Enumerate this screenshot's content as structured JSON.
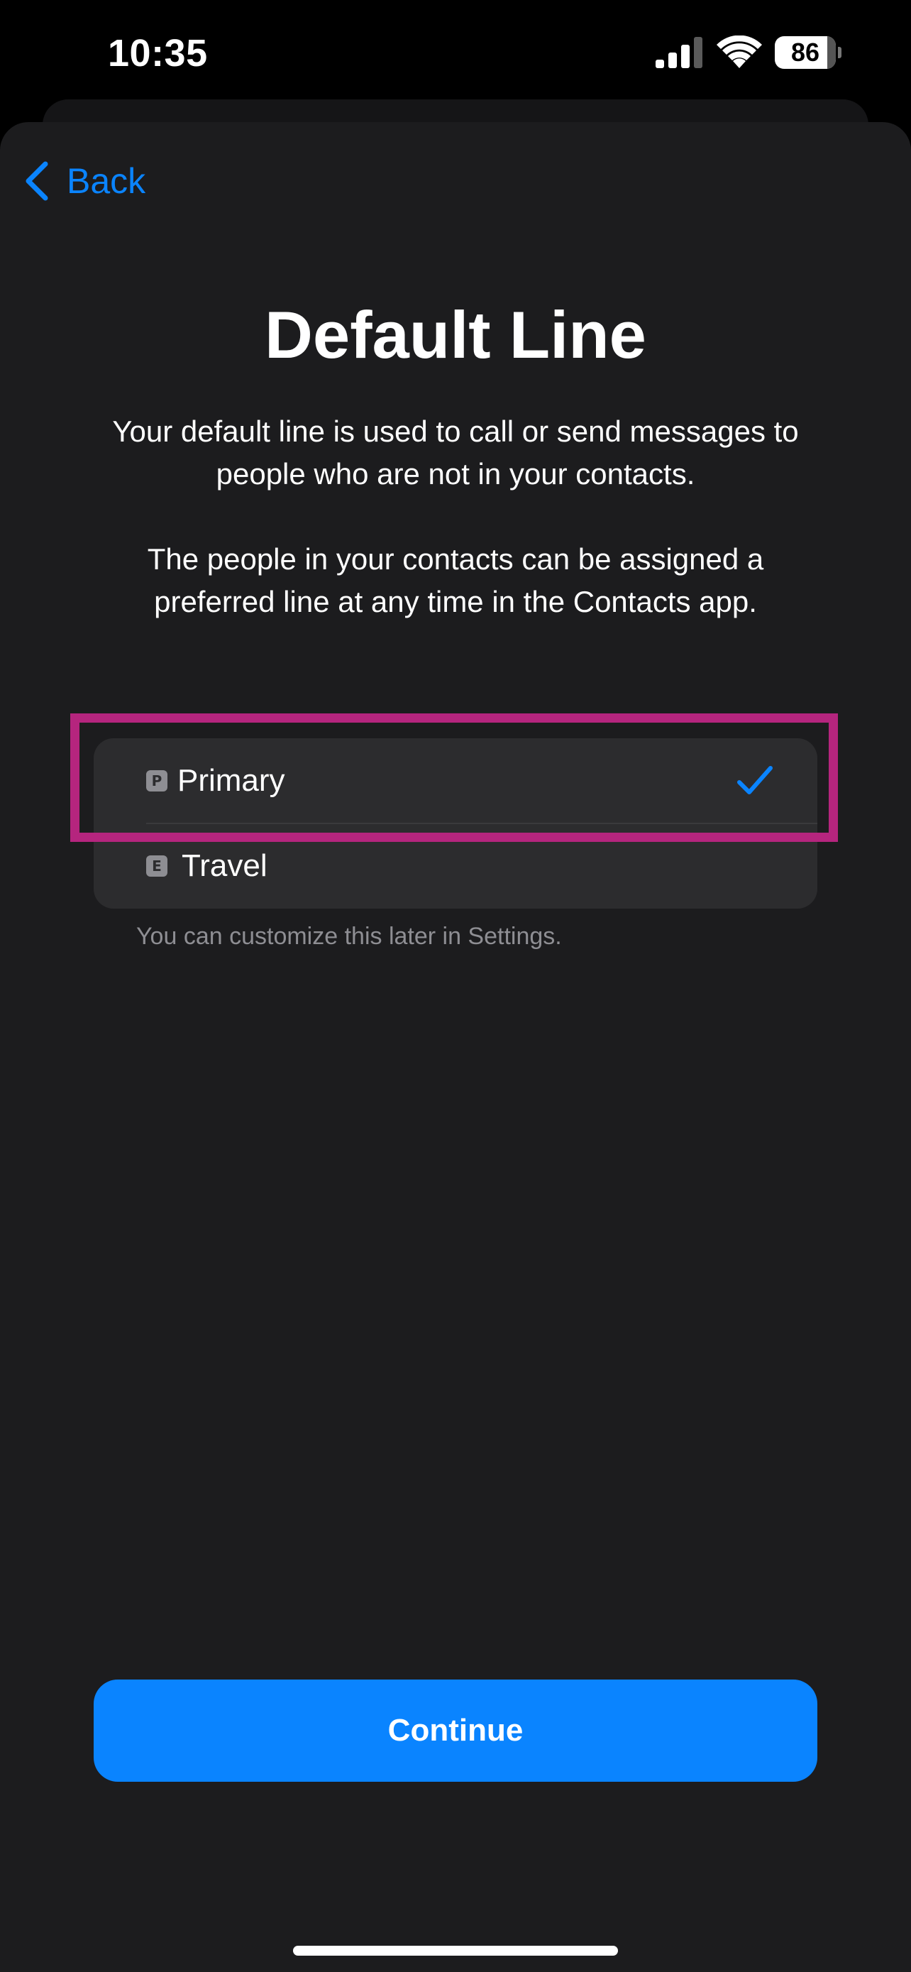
{
  "status_bar": {
    "time": "10:35",
    "battery_percent": "86",
    "battery_level": 0.86,
    "icons": [
      "cellular-signal-icon",
      "wifi-icon",
      "battery-icon"
    ]
  },
  "nav": {
    "back_label": "Back"
  },
  "page": {
    "title": "Default Line",
    "description_1": "Your default line is used to call or send messages to people who are not in your contacts.",
    "description_2": "The people in your contacts can be assigned a preferred line at any time in the Contacts app."
  },
  "options": [
    {
      "badge": "P",
      "label": "Primary",
      "selected": true
    },
    {
      "badge": "E",
      "label": "Travel",
      "selected": false
    }
  ],
  "footnote": "You can customize this later in Settings.",
  "continue_label": "Continue",
  "colors": {
    "accent": "#0a84ff",
    "sheet_background": "#1c1c1e",
    "list_background": "#2c2c2e",
    "highlight": "#b5257e"
  }
}
